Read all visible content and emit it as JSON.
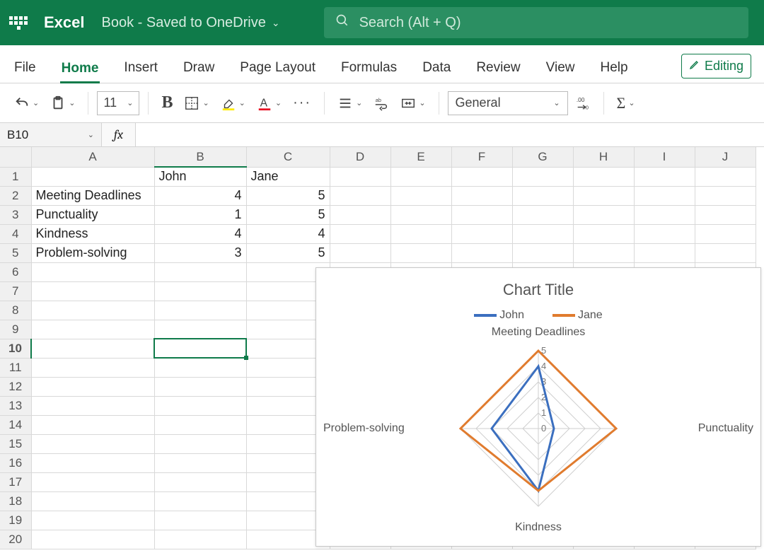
{
  "header": {
    "app_name": "Excel",
    "doc_name": "Book  -  Saved to OneDrive",
    "search_placeholder": "Search (Alt + Q)"
  },
  "ribbon": {
    "tabs": [
      "File",
      "Home",
      "Insert",
      "Draw",
      "Page Layout",
      "Formulas",
      "Data",
      "Review",
      "View",
      "Help"
    ],
    "active_tab": "Home",
    "editing_label": "Editing",
    "font_size": "11",
    "number_format": "General"
  },
  "fx": {
    "namebox": "B10",
    "fx_label": "fx",
    "formula": ""
  },
  "grid": {
    "columns": [
      "A",
      "B",
      "C",
      "D",
      "E",
      "F",
      "G",
      "H",
      "I",
      "J"
    ],
    "row_count": 20,
    "selected_cell": "B10",
    "cells": {
      "B1": "John",
      "C1": "Jane",
      "A2": "Meeting Deadlines",
      "B2": "4",
      "C2": "5",
      "A3": "Punctuality",
      "B3": "1",
      "C3": "5",
      "A4": "Kindness",
      "B4": "4",
      "C4": "4",
      "A5": "Problem-solving",
      "B5": "3",
      "C5": "5"
    }
  },
  "chart": {
    "title": "Chart Title",
    "legend": {
      "s1": "John",
      "s2": "Jane"
    },
    "axis_labels": {
      "top": "Meeting Deadlines",
      "right": "Punctuality",
      "bottom": "Kindness",
      "left": "Problem-solving"
    },
    "ticks": [
      "5",
      "4",
      "3",
      "2",
      "1",
      "0"
    ]
  },
  "chart_data": {
    "type": "radar",
    "categories": [
      "Meeting Deadlines",
      "Punctuality",
      "Kindness",
      "Problem-solving"
    ],
    "series": [
      {
        "name": "John",
        "color": "#3b6fbf",
        "values": [
          4,
          1,
          4,
          3
        ]
      },
      {
        "name": "Jane",
        "color": "#e07b2e",
        "values": [
          5,
          5,
          4,
          5
        ]
      }
    ],
    "title": "Chart Title",
    "axis_max": 5,
    "axis_min": 0,
    "tick_step": 1
  },
  "colors": {
    "brand": "#0f7b4a",
    "series_john": "#3b6fbf",
    "series_jane": "#e07b2e"
  }
}
